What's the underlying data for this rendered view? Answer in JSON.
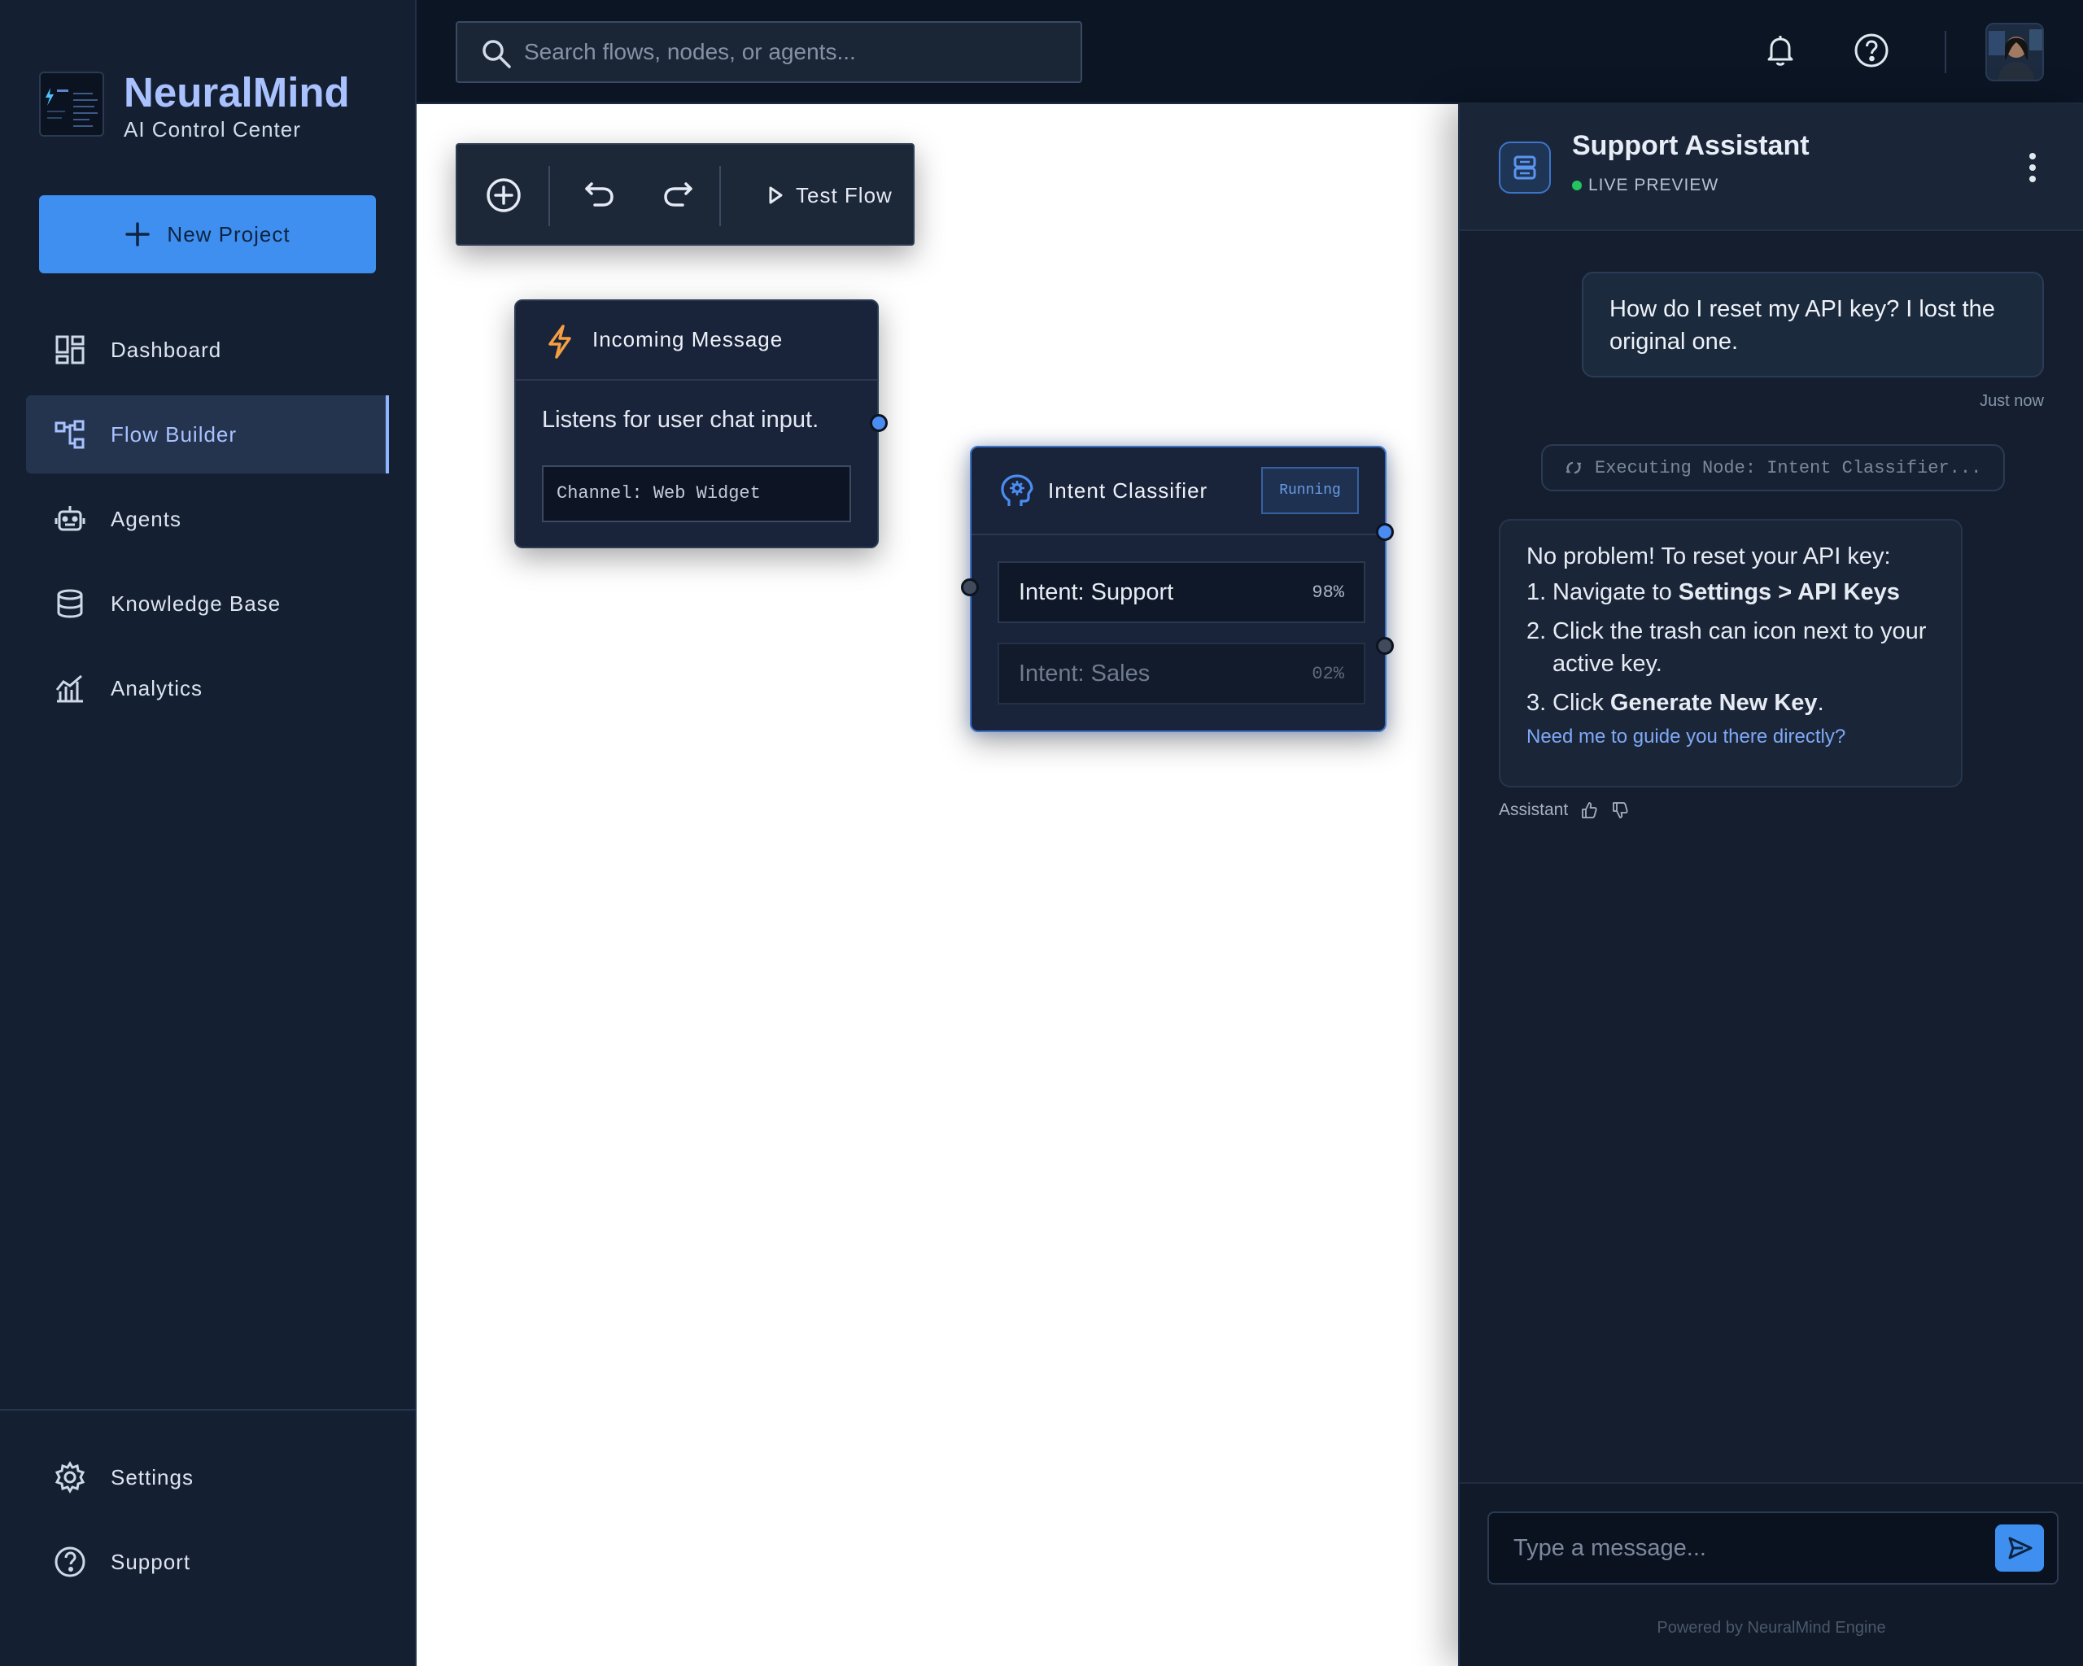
{
  "brand": {
    "name": "NeuralMind",
    "subtitle": "AI Control Center"
  },
  "sidebar": {
    "new_project_label": "New Project",
    "items": [
      {
        "label": "Dashboard",
        "icon": "dashboard-icon",
        "active": false
      },
      {
        "label": "Flow Builder",
        "icon": "flow-builder-icon",
        "active": true
      },
      {
        "label": "Agents",
        "icon": "robot-icon",
        "active": false
      },
      {
        "label": "Knowledge Base",
        "icon": "database-icon",
        "active": false
      },
      {
        "label": "Analytics",
        "icon": "analytics-icon",
        "active": false
      }
    ],
    "bottom_items": [
      {
        "label": "Settings",
        "icon": "gear-icon"
      },
      {
        "label": "Support",
        "icon": "help-circle-icon"
      }
    ]
  },
  "topbar": {
    "search_placeholder": "Search flows, nodes, or agents...",
    "icons": [
      "bell-icon",
      "help-circle-icon",
      "avatar"
    ]
  },
  "toolbar": {
    "test_flow_label": "Test Flow",
    "icons": [
      "add-node-icon",
      "undo-icon",
      "redo-icon",
      "play-icon"
    ]
  },
  "nodes": {
    "incoming": {
      "title": "Incoming Message",
      "description": "Listens for user chat input.",
      "field": "Channel: Web Widget",
      "icon": "lightning-icon",
      "icon_color": "#f59e42"
    },
    "classifier": {
      "title": "Intent Classifier",
      "status": "Running",
      "icon": "brain-gear-icon",
      "rows": [
        {
          "name": "Intent: Support",
          "pct": "98%"
        },
        {
          "name": "Intent: Sales",
          "pct": "02%"
        }
      ]
    }
  },
  "chat": {
    "title": "Support Assistant",
    "status": "LIVE PREVIEW",
    "user_message": "How do I reset my API key? I lost the original one.",
    "user_time": "Just now",
    "executing": "Executing Node: Intent Classifier...",
    "bot": {
      "lead": "No problem! To reset your API key:",
      "step1_prefix": "Navigate to ",
      "step1_bold": "Settings > API Keys",
      "step2": "Click the trash can icon next to your active key.",
      "step3_prefix": "Click ",
      "step3_bold": "Generate New Key",
      "step3_suffix": ".",
      "link": "Need me to guide you there directly?",
      "sender": "Assistant"
    },
    "composer_placeholder": "Type a message...",
    "footer": "Powered by NeuralMind Engine"
  },
  "colors": {
    "accent": "#3f8ff0",
    "brand_text": "#a9c2ff",
    "live_dot": "#22c55e",
    "sidebar_bg": "#142032",
    "panel_bg": "#141e2e"
  }
}
